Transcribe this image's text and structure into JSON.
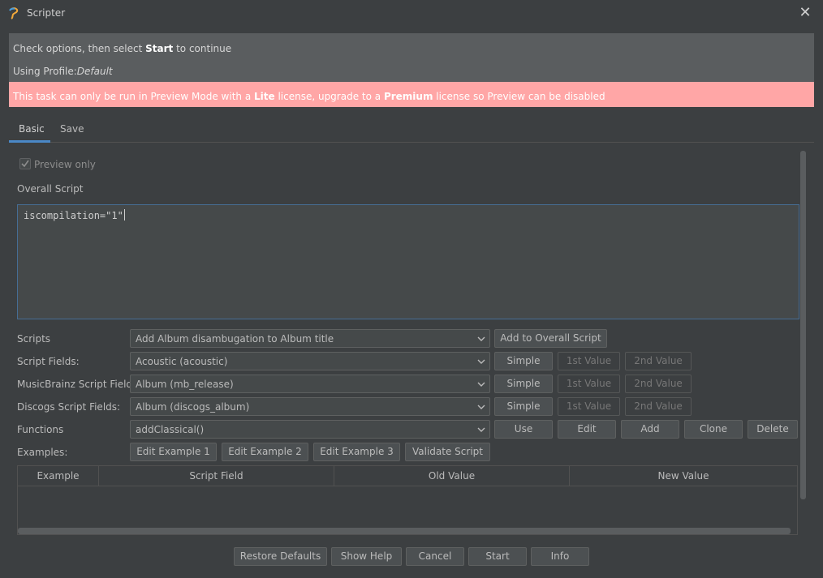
{
  "window": {
    "title": "Scripter"
  },
  "info": {
    "line1_prefix": "Check options, then select ",
    "line1_bold": "Start",
    "line1_suffix": " to continue",
    "profile_label": "Using Profile:",
    "profile_value": "Default"
  },
  "warning": {
    "part1": "This task can only be run in Preview Mode with a ",
    "bold1": "Lite",
    "part2": " license, upgrade to a ",
    "bold2": "Premium",
    "part3": " license so Preview can be disabled"
  },
  "tabs": [
    {
      "label": "Basic"
    },
    {
      "label": "Save"
    }
  ],
  "preview_only": {
    "label": "Preview only",
    "checked": true
  },
  "overall_script": {
    "label": "Overall Script",
    "value": "iscompilation=\"1\""
  },
  "rows": {
    "scripts": {
      "label": "Scripts",
      "value": "Add Album disambugation to Album title",
      "button": "Add to Overall Script"
    },
    "script_fields": {
      "label": "Script Fields:",
      "value": "Acoustic (acoustic)"
    },
    "mb_fields": {
      "label": "MusicBrainz Script Fields:",
      "value": "Album (mb_release)"
    },
    "discogs_fields": {
      "label": "Discogs Script Fields:",
      "value": "Album (discogs_album)"
    },
    "functions": {
      "label": "Functions",
      "value": "addClassical()"
    },
    "examples": {
      "label": "Examples:"
    }
  },
  "field_buttons": {
    "simple": "Simple",
    "first": "1st Value",
    "second": "2nd Value"
  },
  "function_buttons": {
    "use": "Use",
    "edit": "Edit",
    "add": "Add",
    "clone": "Clone",
    "delete": "Delete"
  },
  "example_buttons": {
    "ex1": "Edit Example 1",
    "ex2": "Edit Example 2",
    "ex3": "Edit Example 3",
    "validate": "Validate Script"
  },
  "table": {
    "columns": [
      "Example",
      "Script Field",
      "Old Value",
      "New Value"
    ]
  },
  "footer": {
    "restore": "Restore Defaults",
    "help": "Show Help",
    "cancel": "Cancel",
    "start": "Start",
    "info": "Info"
  },
  "colors": {
    "accent": "#4a88c7",
    "warning_bg": "#ffa6a6",
    "background": "#3c3f41"
  }
}
